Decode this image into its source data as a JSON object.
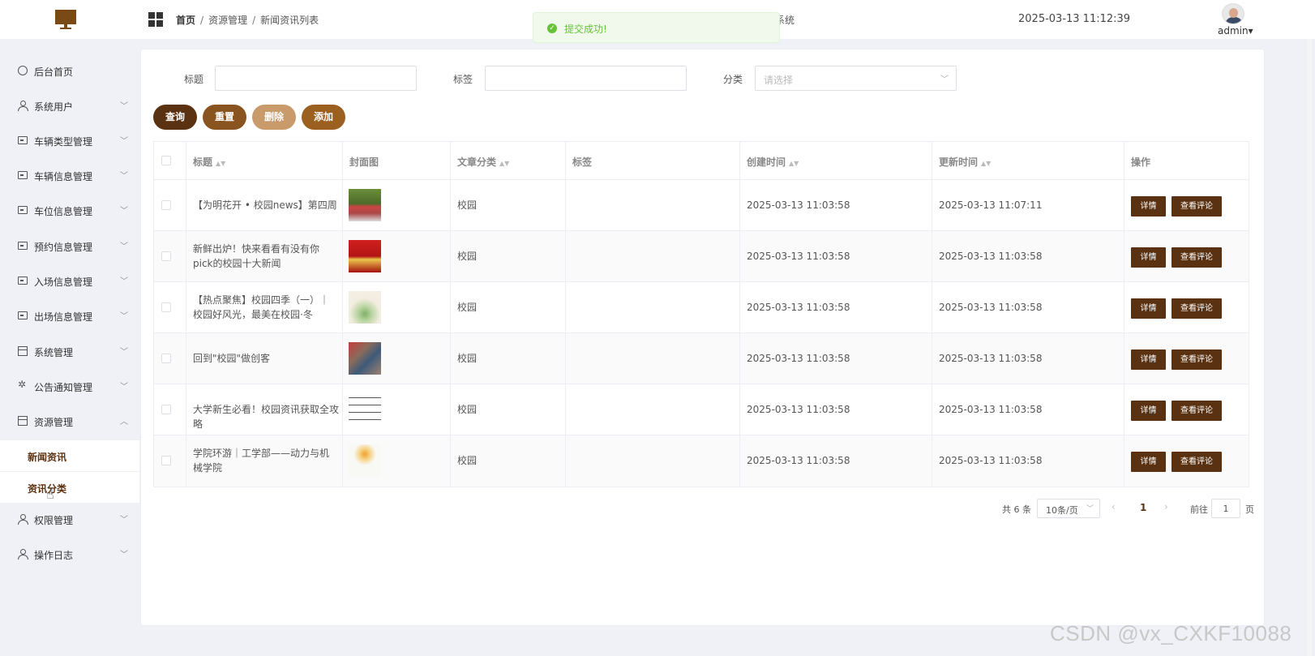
{
  "header": {
    "breadcrumb": [
      "首页",
      "资源管理",
      "新闻资讯列表"
    ],
    "breadcrumb_sep": "/",
    "title_fragment": "系统",
    "datetime": "2025-03-13 11:12:39",
    "user": "admin",
    "user_caret": "▾"
  },
  "toast": {
    "message": "提交成功!",
    "type": "success"
  },
  "sidebar": {
    "items": [
      {
        "label": "后台首页",
        "icon": "clock-icon",
        "expandable": false
      },
      {
        "label": "系统用户",
        "icon": "user-icon",
        "expandable": true
      },
      {
        "label": "车辆类型管理",
        "icon": "card-icon",
        "expandable": true
      },
      {
        "label": "车辆信息管理",
        "icon": "card-icon",
        "expandable": true
      },
      {
        "label": "车位信息管理",
        "icon": "card-icon",
        "expandable": true
      },
      {
        "label": "预约信息管理",
        "icon": "card-icon",
        "expandable": true
      },
      {
        "label": "入场信息管理",
        "icon": "card-icon",
        "expandable": true
      },
      {
        "label": "出场信息管理",
        "icon": "card-icon",
        "expandable": true
      },
      {
        "label": "系统管理",
        "icon": "gift-icon",
        "expandable": true
      },
      {
        "label": "公告通知管理",
        "icon": "loading-icon",
        "expandable": true
      },
      {
        "label": "资源管理",
        "icon": "gift-icon",
        "expandable": true,
        "expanded": true,
        "children": [
          {
            "label": "新闻资讯"
          },
          {
            "label": "资讯分类"
          }
        ]
      },
      {
        "label": "权限管理",
        "icon": "user-icon",
        "expandable": true
      },
      {
        "label": "操作日志",
        "icon": "user-icon",
        "expandable": true
      }
    ]
  },
  "filters": {
    "title_label": "标题",
    "title_value": "",
    "tag_label": "标签",
    "tag_value": "",
    "category_label": "分类",
    "category_placeholder": "请选择"
  },
  "buttons": {
    "query": "查询",
    "reset": "重置",
    "delete": "删除",
    "add": "添加"
  },
  "colors": {
    "brand": "#5b3211",
    "btn_reset": "#8a5420",
    "btn_delete": "#c99a6a",
    "btn_add": "#9b5f20",
    "success": "#67c23a"
  },
  "table": {
    "columns": [
      "标题",
      "封面图",
      "文章分类",
      "标签",
      "创建时间",
      "更新时间",
      "操作"
    ],
    "rows": [
      {
        "title": "【为明花开 • 校园news】第四周",
        "category": "校园",
        "tag": "",
        "created": "2025-03-13 11:03:58",
        "updated": "2025-03-13 11:07:11"
      },
      {
        "title": "新鲜出炉！快来看看有没有你pick的校园十大新闻",
        "category": "校园",
        "tag": "",
        "created": "2025-03-13 11:03:58",
        "updated": "2025-03-13 11:03:58"
      },
      {
        "title": "【热点聚焦】校园四季（一）｜校园好风光，最美在校园·冬",
        "category": "校园",
        "tag": "",
        "created": "2025-03-13 11:03:58",
        "updated": "2025-03-13 11:03:58"
      },
      {
        "title": "回到\"校园\"做创客",
        "category": "校园",
        "tag": "",
        "created": "2025-03-13 11:03:58",
        "updated": "2025-03-13 11:03:58"
      },
      {
        "title": "大学新生必看！校园资讯获取全攻略",
        "category": "校园",
        "tag": "",
        "created": "2025-03-13 11:03:58",
        "updated": "2025-03-13 11:03:58"
      },
      {
        "title": "学院环游｜工学部——动力与机械学院",
        "category": "校园",
        "tag": "",
        "created": "2025-03-13 11:03:58",
        "updated": "2025-03-13 11:03:58"
      }
    ],
    "row_actions": {
      "detail": "详情",
      "comments": "查看评论"
    }
  },
  "pagination": {
    "total": "共 6 条",
    "page_size": "10条/页",
    "current_page": "1",
    "goto_label": "前往",
    "goto_value": "1",
    "page_suffix": "页",
    "prev": "‹",
    "next": "›"
  },
  "watermark": "CSDN @vx_CXKF10088"
}
